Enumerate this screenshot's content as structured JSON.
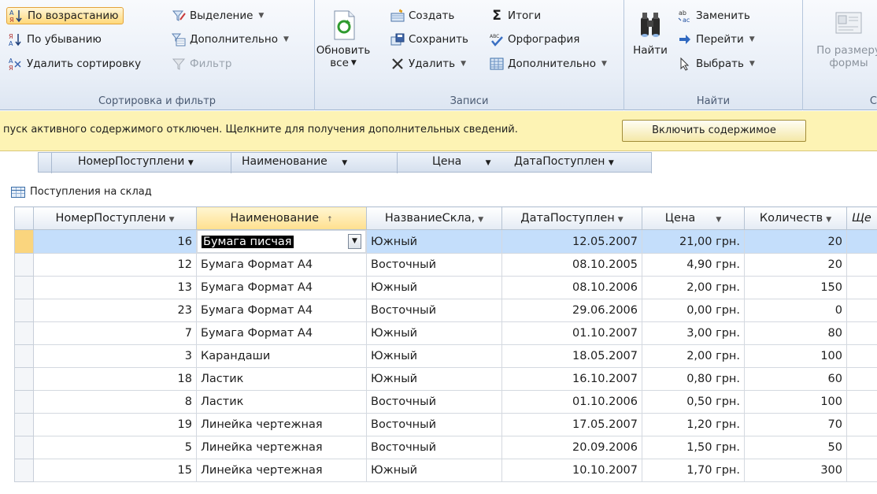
{
  "ribbon": {
    "sort_filter": {
      "ascending": "По возрастанию",
      "descending": "По убыванию",
      "clear_sort": "Удалить сортировку",
      "selection": "Выделение",
      "advanced": "Дополнительно",
      "filter": "Фильтр",
      "group_label": "Сортировка и фильтр"
    },
    "records": {
      "refresh_all_line1": "Обновить",
      "refresh_all_line2": "все",
      "new": "Создать",
      "save": "Сохранить",
      "delete": "Удалить",
      "totals": "Итоги",
      "spelling": "Орфография",
      "more": "Дополнительно",
      "group_label": "Записи"
    },
    "find": {
      "find": "Найти",
      "replace": "Заменить",
      "goto": "Перейти",
      "select": "Выбрать",
      "group_label": "Найти"
    },
    "window": {
      "size_to_fit_line1": "По размеру",
      "size_to_fit_line2": "формы",
      "group_label_partial": "С"
    }
  },
  "message_bar": {
    "text": "пуск активного содержимого отключен. Щелкните для получения дополнительных сведений.",
    "enable_button": "Включить содержимое"
  },
  "query_strip": {
    "columns": [
      "НомерПоступлени",
      "Наименование",
      "Цена",
      "ДатаПоступлен"
    ]
  },
  "table": {
    "title": "Поступления на склад",
    "columns": [
      "НомерПоступлени",
      "Наименование",
      "НазваниеСкла,",
      "ДатаПоступлен",
      "Цена",
      "Количеств",
      "Ще"
    ],
    "rows": [
      {
        "id": "16",
        "name": "Бумага писчая",
        "warehouse": "Южный",
        "date": "12.05.2007",
        "price": "21,00 грн.",
        "qty": "20"
      },
      {
        "id": "12",
        "name": "Бумага Формат А4",
        "warehouse": "Восточный",
        "date": "08.10.2005",
        "price": "4,90 грн.",
        "qty": "20"
      },
      {
        "id": "13",
        "name": "Бумага Формат А4",
        "warehouse": "Южный",
        "date": "08.10.2006",
        "price": "2,00 грн.",
        "qty": "150"
      },
      {
        "id": "23",
        "name": "Бумага Формат А4",
        "warehouse": "Восточный",
        "date": "29.06.2006",
        "price": "0,00 грн.",
        "qty": "0"
      },
      {
        "id": "7",
        "name": "Бумага Формат А4",
        "warehouse": "Южный",
        "date": "01.10.2007",
        "price": "3,00 грн.",
        "qty": "80"
      },
      {
        "id": "3",
        "name": "Карандаши",
        "warehouse": "Южный",
        "date": "18.05.2007",
        "price": "2,00 грн.",
        "qty": "100"
      },
      {
        "id": "18",
        "name": "Ластик",
        "warehouse": "Южный",
        "date": "16.10.2007",
        "price": "0,80 грн.",
        "qty": "60"
      },
      {
        "id": "8",
        "name": "Ластик",
        "warehouse": "Восточный",
        "date": "01.10.2006",
        "price": "0,50 грн.",
        "qty": "100"
      },
      {
        "id": "19",
        "name": "Линейка чертежная",
        "warehouse": "Восточный",
        "date": "17.05.2007",
        "price": "1,20 грн.",
        "qty": "70"
      },
      {
        "id": "5",
        "name": "Линейка чертежная",
        "warehouse": "Восточный",
        "date": "20.09.2006",
        "price": "1,50 грн.",
        "qty": "50"
      },
      {
        "id": "15",
        "name": "Линейка чертежная",
        "warehouse": "Южный",
        "date": "10.10.2007",
        "price": "1,70 грн.",
        "qty": "300"
      }
    ]
  },
  "colors": {
    "selected_row": "#c4defb",
    "sorted_header": "#ffdf8e",
    "message_bar": "#fdf3b4"
  }
}
